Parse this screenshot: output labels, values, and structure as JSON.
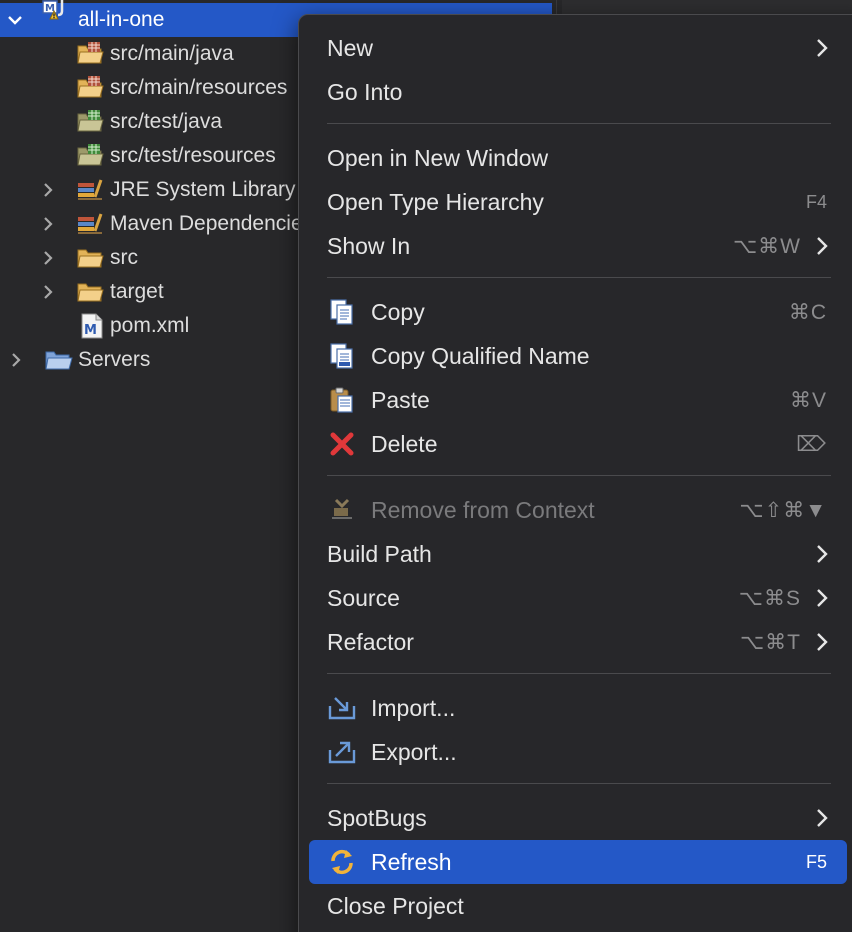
{
  "explorer": {
    "project": {
      "label": "all-in-one",
      "expanded": true,
      "selected": true,
      "icon": "maven-project-warning-icon"
    },
    "children": [
      {
        "label": "src/main/java",
        "icon": "source-folder-icon",
        "expandable": false
      },
      {
        "label": "src/main/resources",
        "icon": "source-folder-icon",
        "expandable": false
      },
      {
        "label": "src/test/java",
        "icon": "test-source-folder-icon",
        "expandable": false
      },
      {
        "label": "src/test/resources",
        "icon": "test-source-folder-icon",
        "expandable": false
      },
      {
        "label": "JRE System Library",
        "icon": "library-icon",
        "expandable": true
      },
      {
        "label": "Maven Dependencies",
        "icon": "library-icon",
        "expandable": true
      },
      {
        "label": "src",
        "icon": "folder-icon",
        "expandable": true
      },
      {
        "label": "target",
        "icon": "folder-icon",
        "expandable": true
      },
      {
        "label": "pom.xml",
        "icon": "maven-pom-icon",
        "expandable": false
      }
    ],
    "servers": {
      "label": "Servers",
      "icon": "folder-icon",
      "expandable": true
    }
  },
  "menu": {
    "new": {
      "label": "New",
      "submenu": true
    },
    "go_into": {
      "label": "Go Into"
    },
    "open_new_window": {
      "label": "Open in New Window"
    },
    "open_type_hierarchy": {
      "label": "Open Type Hierarchy",
      "shortcut": "F4"
    },
    "show_in": {
      "label": "Show In",
      "shortcut": "⌥⌘W",
      "submenu": true
    },
    "copy": {
      "label": "Copy",
      "shortcut": "⌘C",
      "icon": "copy-icon"
    },
    "copy_qualified_name": {
      "label": "Copy Qualified Name",
      "icon": "copy-qualified-name-icon"
    },
    "paste": {
      "label": "Paste",
      "shortcut": "⌘V",
      "icon": "paste-icon"
    },
    "delete": {
      "label": "Delete",
      "shortcut": "⌦",
      "icon": "delete-icon"
    },
    "remove_from_context": {
      "label": "Remove from Context",
      "shortcut": "⌥⇧⌘▼",
      "icon": "remove-from-context-icon",
      "disabled": true
    },
    "build_path": {
      "label": "Build Path",
      "submenu": true
    },
    "source": {
      "label": "Source",
      "shortcut": "⌥⌘S",
      "submenu": true
    },
    "refactor": {
      "label": "Refactor",
      "shortcut": "⌥⌘T",
      "submenu": true
    },
    "import": {
      "label": "Import...",
      "icon": "import-icon"
    },
    "export": {
      "label": "Export...",
      "icon": "export-icon"
    },
    "spotbugs": {
      "label": "SpotBugs",
      "submenu": true
    },
    "refresh": {
      "label": "Refresh",
      "shortcut": "F5",
      "icon": "refresh-icon",
      "highlighted": true
    },
    "close_project": {
      "label": "Close Project"
    }
  },
  "colors": {
    "selection": "#2458c7",
    "menu_background": "#27272a",
    "explorer_background": "#28282a",
    "disabled_text": "#7a7a7c"
  }
}
